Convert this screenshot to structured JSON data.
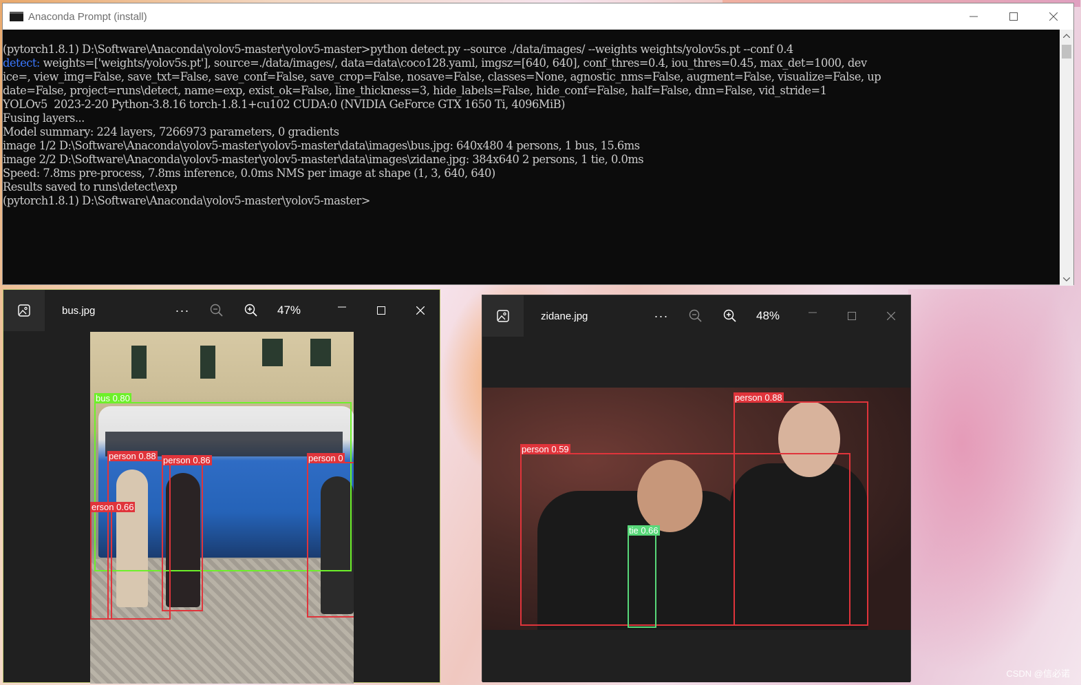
{
  "console": {
    "title": "Anaconda Prompt (install)",
    "lines": [
      "(pytorch1.8.1) D:\\Software\\Anaconda\\yolov5-master\\yolov5-master>python detect.py --source ./data/images/ --weights weights/yolov5s.pt --conf 0.4",
      "weights=['weights/yolov5s.pt'], source=./data/images/, data=data\\coco128.yaml, imgsz=[640, 640], conf_thres=0.4, iou_thres=0.45, max_det=1000, dev",
      "ice=, view_img=False, save_txt=False, save_conf=False, save_crop=False, nosave=False, classes=None, agnostic_nms=False, augment=False, visualize=False, up",
      "date=False, project=runs\\detect, name=exp, exist_ok=False, line_thickness=3, hide_labels=False, hide_conf=False, half=False, dnn=False, vid_stride=1",
      "YOLOv5  2023-2-20 Python-3.8.16 torch-1.8.1+cu102 CUDA:0 (NVIDIA GeForce GTX 1650 Ti, 4096MiB)",
      "",
      "Fusing layers...",
      "Model summary: 224 layers, 7266973 parameters, 0 gradients",
      "image 1/2 D:\\Software\\Anaconda\\yolov5-master\\yolov5-master\\data\\images\\bus.jpg: 640x480 4 persons, 1 bus, 15.6ms",
      "image 2/2 D:\\Software\\Anaconda\\yolov5-master\\yolov5-master\\data\\images\\zidane.jpg: 384x640 2 persons, 1 tie, 0.0ms",
      "Speed: 7.8ms pre-process, 7.8ms inference, 0.0ms NMS per image at shape (1, 3, 640, 640)",
      "Results saved to runs\\detect\\exp",
      "",
      "(pytorch1.8.1) D:\\Software\\Anaconda\\yolov5-master\\yolov5-master>"
    ],
    "detect_prefix": "detect: "
  },
  "viewer1": {
    "filename": "bus.jpg",
    "more": "···",
    "zoom": "47%",
    "detections": [
      {
        "label": "bus 0.80",
        "color": "#6df02a"
      },
      {
        "label": "person 0.88",
        "color": "#e0343b"
      },
      {
        "label": "person 0.86",
        "color": "#e0343b"
      },
      {
        "label": "person 0",
        "color": "#e0343b"
      },
      {
        "label": "erson 0.66",
        "color": "#e0343b"
      }
    ]
  },
  "viewer2": {
    "filename": "zidane.jpg",
    "more": "···",
    "zoom": "48%",
    "detections": [
      {
        "label": "person 0.88",
        "color": "#e0343b"
      },
      {
        "label": "person 0.59",
        "color": "#e0343b"
      },
      {
        "label": "tie 0.66",
        "color": "#58d879"
      }
    ]
  },
  "watermark": "CSDN @信必诺"
}
